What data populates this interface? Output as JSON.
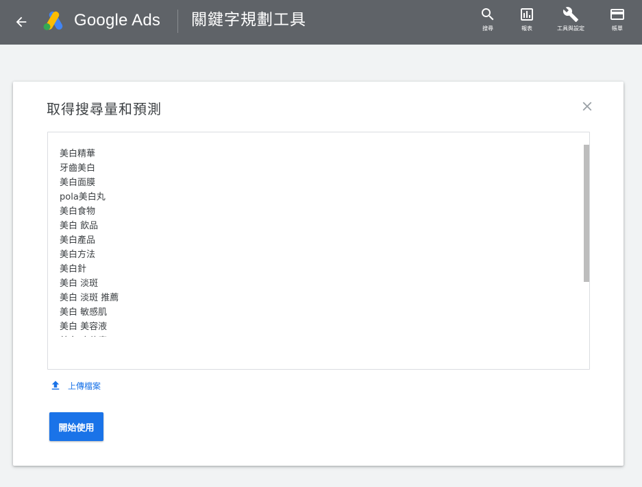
{
  "header": {
    "product_name": "Google Ads",
    "page_title": "關鍵字規劃工具",
    "tools": [
      {
        "label": "搜尋",
        "icon": "search-icon"
      },
      {
        "label": "報表",
        "icon": "reports-icon"
      },
      {
        "label": "工具與設定",
        "icon": "wrench-icon"
      },
      {
        "label": "帳單",
        "icon": "billing-icon"
      }
    ],
    "colors": {
      "bar": "#5f6368",
      "text": "#ffffff"
    }
  },
  "dialog": {
    "title": "取得搜尋量和預測",
    "keywords": [
      "美白精華",
      "牙齒美白",
      "美白面膜",
      "pola美白丸",
      "美白食物",
      "美白 飲品",
      "美白產品",
      "美白方法",
      "美白針",
      "美白 淡斑",
      "美白 淡斑 推薦",
      "美白 敏感肌",
      "美白 美容液",
      "美白 吃什麼"
    ],
    "upload_label": "上傳檔案",
    "start_label": "開始使用",
    "colors": {
      "primary": "#1a73e8"
    }
  }
}
